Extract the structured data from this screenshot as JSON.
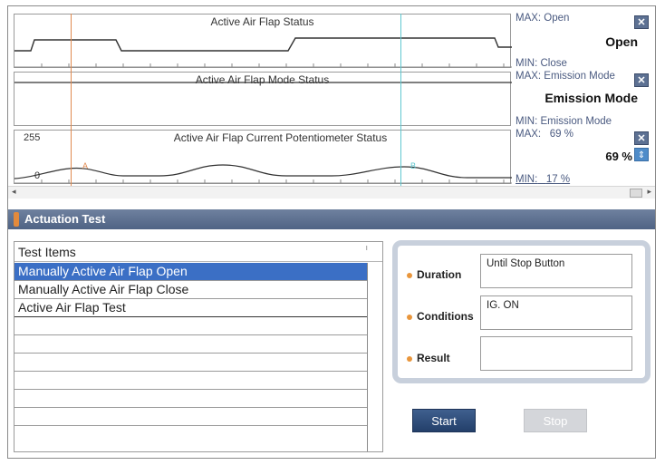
{
  "graphs": [
    {
      "title": "Active Air Flap Status",
      "max_label": "MAX: Open",
      "current": "Open",
      "min_label": "MIN: Close",
      "close_icon": "close-icon"
    },
    {
      "title": "Active Air Flap Mode Status",
      "max_label": "MAX: Emission Mode",
      "current": "Emission Mode",
      "min_label": "MIN: Emission Mode",
      "close_icon": "close-icon"
    },
    {
      "title": "Active Air Flap Current Potentiometer Status",
      "y_top": "255",
      "y_bottom": "0",
      "cursor_a": "A",
      "cursor_b": "B",
      "max_label": "MAX:",
      "max_value": "69 %",
      "current": "69 %",
      "min_label": "MIN:",
      "min_value": "17 %",
      "close_icon": "close-icon",
      "sort_icon": "up-down-arrows-icon"
    }
  ],
  "scrollbar": {
    "left_arrow": "◂",
    "right_arrow": "▸"
  },
  "actuation": {
    "title": "Actuation Test",
    "list_header": "Test Items",
    "items": [
      "Manually Active Air Flap Open",
      "Manually Active Air Flap Close",
      "Active Air Flap Test"
    ],
    "fields": {
      "duration_label": "Duration",
      "duration_value": "Until Stop Button",
      "conditions_label": "Conditions",
      "conditions_value": "IG. ON",
      "result_label": "Result",
      "result_value": ""
    },
    "start_label": "Start",
    "stop_label": "Stop"
  },
  "colors": {
    "cursor_a": "#e08a50",
    "cursor_b": "#5fc8d0",
    "selected_row": "#3b6fc5",
    "header_bar": "#5a6d8e",
    "start_button": "#2d4b78"
  }
}
